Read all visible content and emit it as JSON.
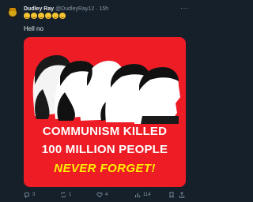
{
  "tweet": {
    "author_name": "Dudley Ray",
    "handle": "@DudleyRay12",
    "separator": "·",
    "time": "15h",
    "more_label": "···",
    "emoji_count": 6,
    "text": "Hell no"
  },
  "media": {
    "caption_line1": "COMMUNISM KILLED",
    "caption_line2": "100 MILLION PEOPLE",
    "caption_line3": "NEVER FORGET!"
  },
  "actions": {
    "replies": "3",
    "retweets": "1",
    "likes": "4",
    "views": "114"
  },
  "colors": {
    "background": "#15202b",
    "poster_red": "#ee1c25",
    "accent_yellow": "#ffef00",
    "muted_text": "#8b98a5"
  },
  "icons": [
    "reply-icon",
    "retweet-icon",
    "like-icon",
    "views-icon",
    "bookmark-icon",
    "share-icon"
  ]
}
